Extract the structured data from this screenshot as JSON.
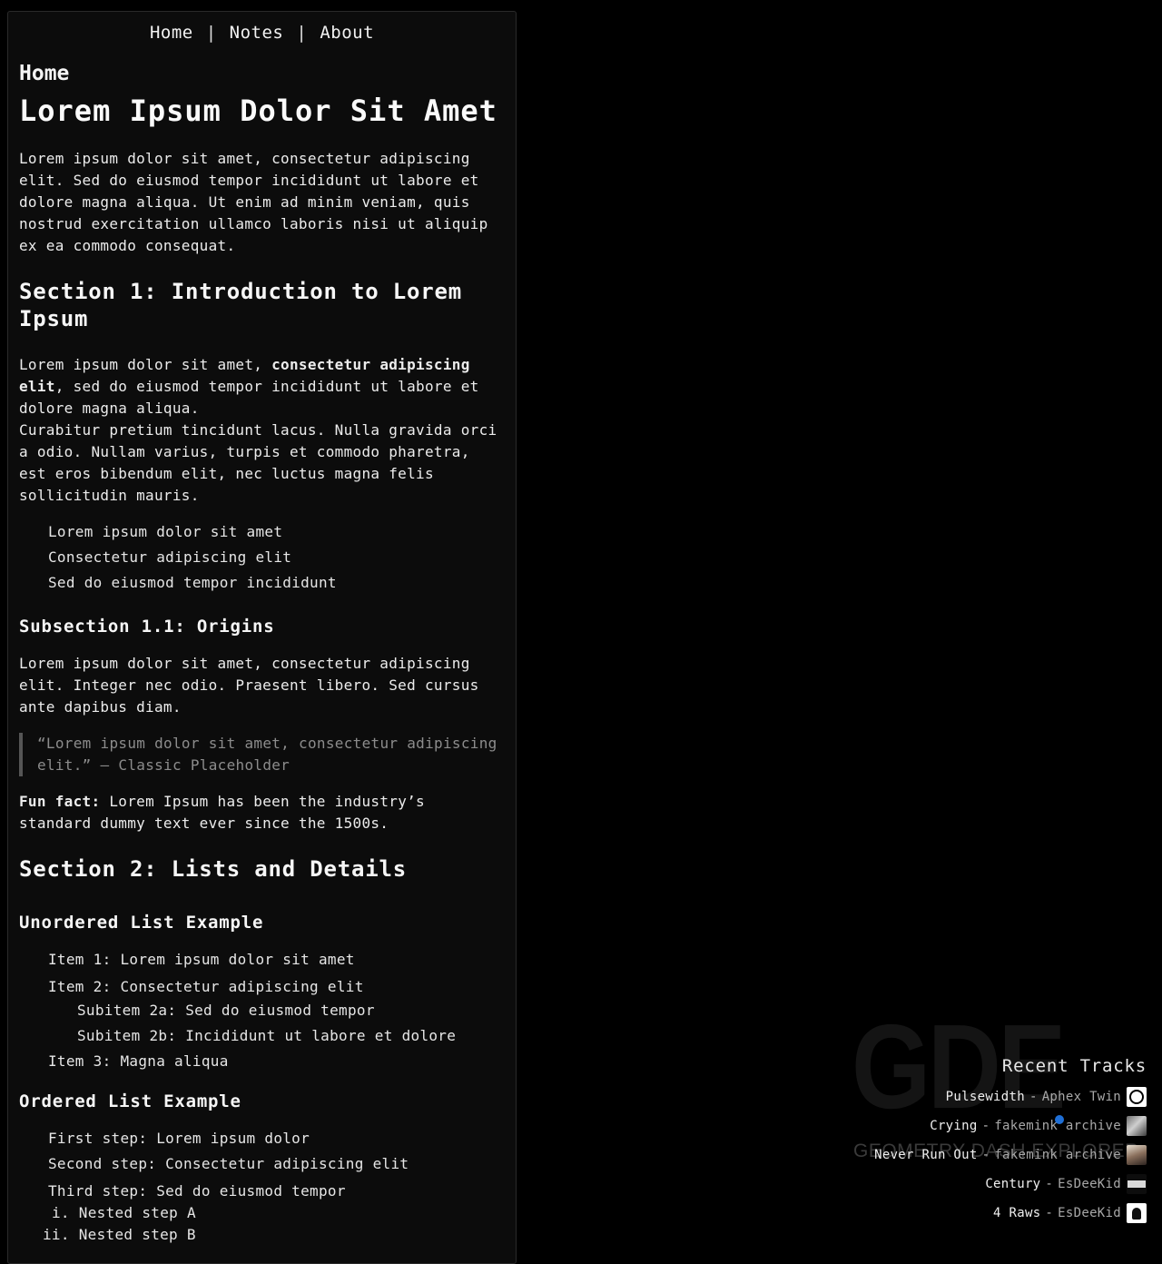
{
  "nav": {
    "items": [
      "Home",
      "Notes",
      "About"
    ],
    "separator": "|"
  },
  "breadcrumb": "Home",
  "title": "Lorem Ipsum Dolor Sit Amet",
  "intro": "Lorem ipsum dolor sit amet, consectetur adipiscing elit. Sed do eiusmod tempor incididunt ut labore et dolore magna aliqua. Ut enim ad minim veniam, quis nostrud exercitation ullamco laboris nisi ut aliquip ex ea commodo consequat.",
  "section1": {
    "heading": "Section 1: Introduction to Lorem Ipsum",
    "p1_pre": "Lorem ipsum dolor sit amet, ",
    "p1_bold": "consectetur adipiscing elit",
    "p1_post": ", sed do eiusmod tempor incididunt ut labore et dolore magna aliqua.",
    "p2": "Curabitur pretium tincidunt lacus. Nulla gravida orci a odio. Nullam varius, turpis et commodo pharetra, est eros bibendum elit, nec luctus magna felis sollicitudin mauris.",
    "list": [
      "Lorem ipsum dolor sit amet",
      "Consectetur adipiscing elit",
      "Sed do eiusmod tempor incididunt"
    ],
    "sub_heading": "Subsection 1.1: Origins",
    "sub_p": "Lorem ipsum dolor sit amet, consectetur adipiscing elit. Integer nec odio. Praesent libero. Sed cursus ante dapibus diam.",
    "quote": "“Lorem ipsum dolor sit amet, consectetur adipiscing elit.” — Classic Placeholder",
    "fun_label": "Fun fact:",
    "fun_text": " Lorem Ipsum has been the industry’s standard dummy text ever since the 1500s."
  },
  "section2": {
    "heading": "Section 2: Lists and Details",
    "ul_heading": "Unordered List Example",
    "ul_items": [
      "Item 1: Lorem ipsum dolor sit amet",
      "Item 2: Consectetur adipiscing elit",
      "Subitem 2a: Sed do eiusmod tempor",
      "Subitem 2b: Incididunt ut labore et dolore",
      "Item 3: Magna aliqua"
    ],
    "ol_heading": "Ordered List Example",
    "ol_items": [
      "First step: Lorem ipsum dolor",
      "Second step: Consectetur adipiscing elit",
      "Third step: Sed do eiusmod tempor",
      "i. Nested step A",
      "ii. Nested step B"
    ]
  },
  "watermark": {
    "big": "GDE",
    "small": "GEOMETRY DASH EXPLORER"
  },
  "recent_tracks": {
    "title": "Recent Tracks",
    "items": [
      {
        "name": "Pulsewidth",
        "artist": "Aphex Twin",
        "thumb": "aphex-twin-logo-icon"
      },
      {
        "name": "Crying",
        "artist": "fakemink archive",
        "thumb": "album-art-icon"
      },
      {
        "name": "Never Run Out",
        "artist": "fakemink archive",
        "thumb": "album-art-icon"
      },
      {
        "name": "Century",
        "artist": "EsDeeKid",
        "thumb": "album-art-icon"
      },
      {
        "name": "4 Raws",
        "artist": "EsDeeKid",
        "thumb": "album-art-icon"
      }
    ],
    "separator": "-"
  }
}
